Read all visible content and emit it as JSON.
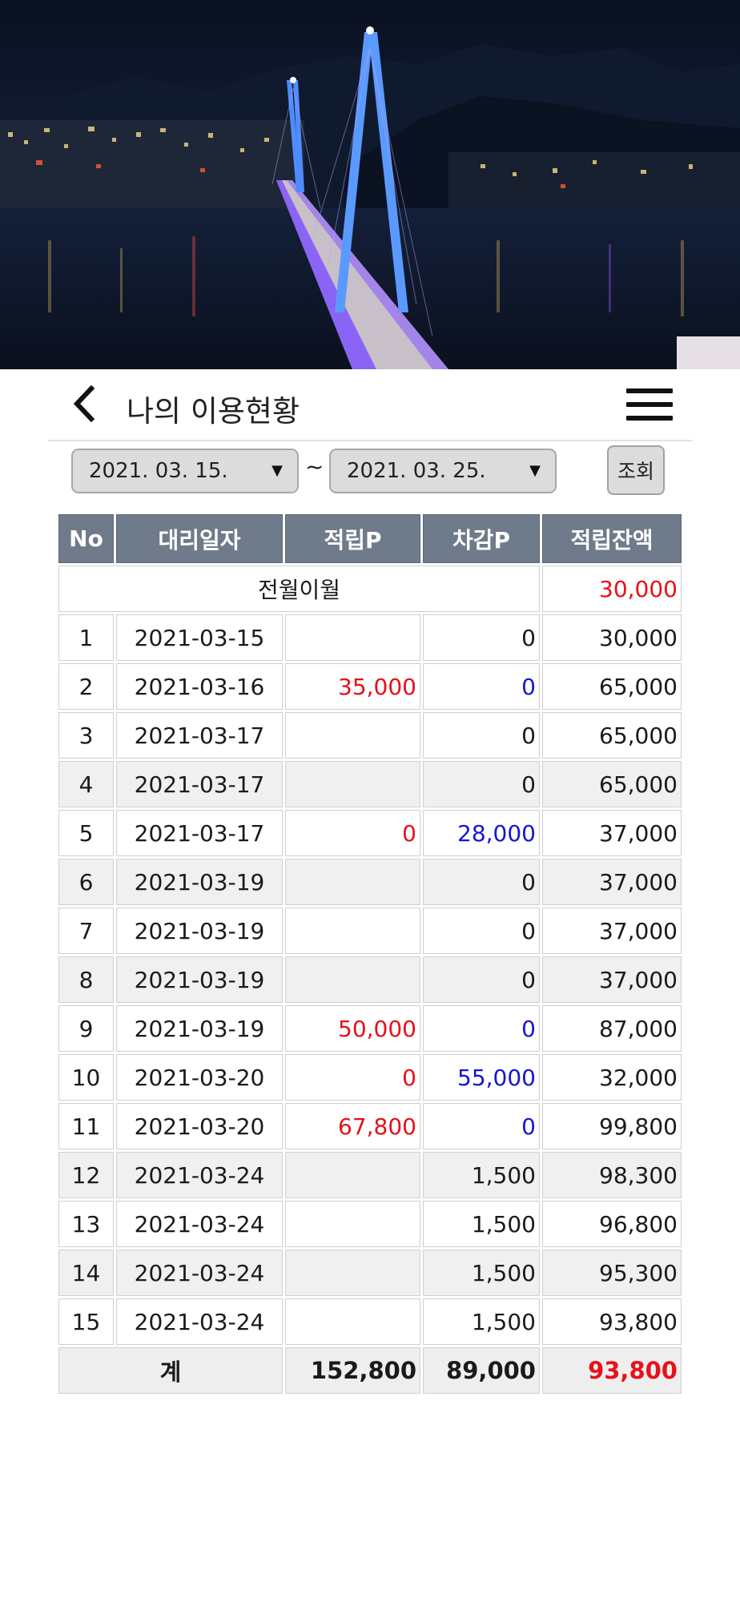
{
  "header": {
    "title": "나의 이용현황"
  },
  "filter": {
    "start_date": "2021. 03. 15.",
    "end_date": "2021. 03. 25.",
    "separator": "~",
    "search_label": "조회"
  },
  "table": {
    "columns": [
      "No",
      "대리일자",
      "적립P",
      "차감P",
      "적립잔액"
    ],
    "carryover": {
      "label": "전월이월",
      "balance": "30,000"
    },
    "rows": [
      {
        "no": "1",
        "date": "2021-03-15",
        "earn": "",
        "deduct": "0",
        "balance": "30,000"
      },
      {
        "no": "2",
        "date": "2021-03-16",
        "earn": "35,000",
        "deduct": "0",
        "balance": "65,000"
      },
      {
        "no": "3",
        "date": "2021-03-17",
        "earn": "",
        "deduct": "0",
        "balance": "65,000"
      },
      {
        "no": "4",
        "date": "2021-03-17",
        "earn": "",
        "deduct": "0",
        "balance": "65,000"
      },
      {
        "no": "5",
        "date": "2021-03-17",
        "earn": "0",
        "deduct": "28,000",
        "balance": "37,000"
      },
      {
        "no": "6",
        "date": "2021-03-19",
        "earn": "",
        "deduct": "0",
        "balance": "37,000"
      },
      {
        "no": "7",
        "date": "2021-03-19",
        "earn": "",
        "deduct": "0",
        "balance": "37,000"
      },
      {
        "no": "8",
        "date": "2021-03-19",
        "earn": "",
        "deduct": "0",
        "balance": "37,000"
      },
      {
        "no": "9",
        "date": "2021-03-19",
        "earn": "50,000",
        "deduct": "0",
        "balance": "87,000"
      },
      {
        "no": "10",
        "date": "2021-03-20",
        "earn": "0",
        "deduct": "55,000",
        "balance": "32,000"
      },
      {
        "no": "11",
        "date": "2021-03-20",
        "earn": "67,800",
        "deduct": "0",
        "balance": "99,800"
      },
      {
        "no": "12",
        "date": "2021-03-24",
        "earn": "",
        "deduct": "1,500",
        "balance": "98,300"
      },
      {
        "no": "13",
        "date": "2021-03-24",
        "earn": "",
        "deduct": "1,500",
        "balance": "96,800"
      },
      {
        "no": "14",
        "date": "2021-03-24",
        "earn": "",
        "deduct": "1,500",
        "balance": "95,300"
      },
      {
        "no": "15",
        "date": "2021-03-24",
        "earn": "",
        "deduct": "1,500",
        "balance": "93,800"
      }
    ],
    "total": {
      "label": "계",
      "earn": "152,800",
      "deduct": "89,000",
      "balance": "93,800"
    }
  },
  "colors": {
    "header_bg": "#6f7b8a",
    "earn_positive": "#e8101a",
    "deduct_highlight": "#1515d8",
    "row_alt": "#f0f0f0"
  },
  "icons": {
    "back": "chevron-left-icon",
    "menu": "hamburger-menu-icon",
    "dropdown": "triangle-down-icon"
  }
}
